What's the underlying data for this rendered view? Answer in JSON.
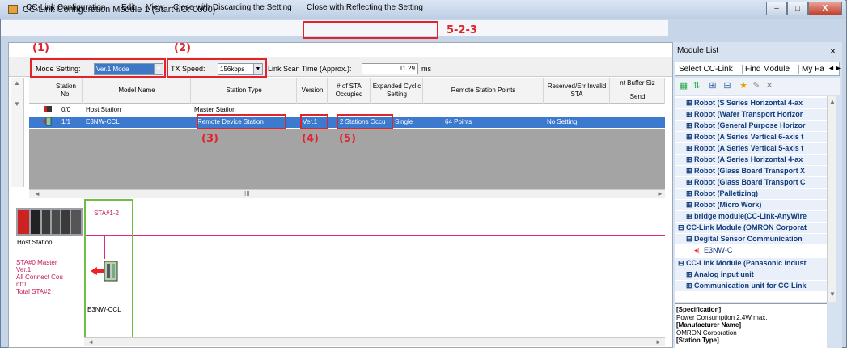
{
  "window": {
    "title": "CC-Link Configuration Module 1 (Start I/O: 0000)",
    "buttons": {
      "minimize": "–",
      "maximize": "□",
      "close": "X"
    }
  },
  "menu": {
    "items": [
      "CC-Link Configuration",
      "Edit",
      "View",
      "Close with Discarding the Setting",
      "Close with Reflecting the Setting"
    ]
  },
  "annotations": {
    "step": "5-2-3",
    "mode": "(1)",
    "speed": "(2)",
    "station_type": "(3)",
    "version": "(4)",
    "sta_occupied": "(5)"
  },
  "settings": {
    "mode_label": "Mode Setting:",
    "mode_value": "Ver.1 Mode",
    "tx_label": "TX Speed:",
    "tx_value": "156kbps",
    "scan_label": "Link Scan Time (Approx.):",
    "scan_value": "11.29",
    "scan_unit": "ms"
  },
  "table": {
    "headers": [
      "Station No.",
      "Model Name",
      "Station Type",
      "Version",
      "# of STA Occupied",
      "Expanded Cyclic Setting",
      "Remote Station Points",
      "Reserved/Err Invalid STA",
      "nt Buffer Siz",
      "Send"
    ],
    "rows": [
      {
        "station_no": "0/0",
        "model": "Host Station",
        "type": "Master Station",
        "version": "",
        "occupied": "",
        "expanded": "",
        "points": "",
        "reserved": ""
      },
      {
        "station_no": "1/1",
        "model": "E3NW-CCL",
        "type": "Remote Device Station",
        "version": "Ver.1",
        "occupied": "2 Stations Occu",
        "expanded": "Single",
        "points": "64 Points",
        "reserved": "No Setting"
      }
    ],
    "scroll_mark": "III"
  },
  "diagram": {
    "host_label": "Host Station",
    "master_info": [
      "STA#0  Master",
      "Ver.1",
      "All Connect Cou",
      "nt:1",
      "Total STA#2"
    ],
    "sta_label": "STA#1-2",
    "device_label": "E3NW-CCL"
  },
  "module_list": {
    "title": "Module List",
    "close": "×",
    "tabs": [
      "Select CC-Link",
      "Find Module",
      "My Fa"
    ],
    "tree": [
      {
        "label": "Robot (S Series Horizontal 4-ax",
        "level": 1
      },
      {
        "label": "Robot (Wafer Transport Horizor",
        "level": 1
      },
      {
        "label": "Robot (General Purpose Horizor",
        "level": 1
      },
      {
        "label": "Robot (A Series Vertical 6-axis t",
        "level": 1
      },
      {
        "label": "Robot (A Series Vertical 5-axis t",
        "level": 1
      },
      {
        "label": "Robot (A Series Horizontal 4-ax",
        "level": 1
      },
      {
        "label": "Robot (Glass Board Transport X",
        "level": 1
      },
      {
        "label": "Robot (Glass Board Transport C",
        "level": 1
      },
      {
        "label": "Robot (Palletizing)",
        "level": 1
      },
      {
        "label": "Robot (Micro Work)",
        "level": 1
      },
      {
        "label": "bridge module(CC-Link-AnyWire",
        "level": 1
      },
      {
        "label": "CC-Link Module (OMRON Corporat",
        "level": 0
      },
      {
        "label": "Degital Sensor Communication",
        "level": 1
      },
      {
        "label": "E3NW-C",
        "level": 2
      },
      {
        "label": "CC-Link Module (Panasonic Indust",
        "level": 0
      },
      {
        "label": "Analog input unit",
        "level": 1
      },
      {
        "label": "Communication unit for CC-Link",
        "level": 1
      }
    ],
    "spec": [
      {
        "text": "[Specification]",
        "bold": true
      },
      {
        "text": "Power Consumption 2.4W max.",
        "bold": false
      },
      {
        "text": "[Manufacturer Name]",
        "bold": true
      },
      {
        "text": "OMRON Corporation",
        "bold": false
      },
      {
        "text": "[Station Type]",
        "bold": true
      }
    ]
  },
  "colors": {
    "annotation_red": "#e2232a",
    "selection_blue": "#3c7ad0",
    "link_magenta": "#e52680",
    "station_green": "#6ebd45"
  }
}
